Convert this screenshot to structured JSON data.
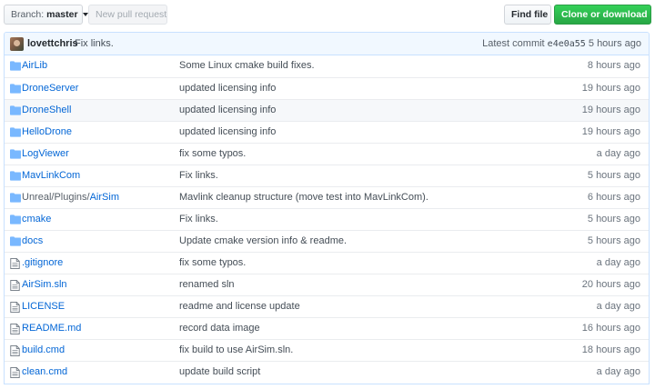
{
  "toolbar": {
    "branch_prefix": "Branch:",
    "branch_name": "master",
    "new_pr": "New pull request",
    "find_file": "Find file",
    "clone": "Clone or download"
  },
  "commit": {
    "author": "lovettchris",
    "message": "Fix links.",
    "latest_label": "Latest commit",
    "sha": "e4e0a55",
    "age": "5 hours ago"
  },
  "files": [
    {
      "type": "dir",
      "prefix": "",
      "name": "AirLib",
      "message": "Some Linux cmake build fixes.",
      "age": "8 hours ago"
    },
    {
      "type": "dir",
      "prefix": "",
      "name": "DroneServer",
      "message": "updated licensing info",
      "age": "19 hours ago"
    },
    {
      "type": "dir",
      "prefix": "",
      "name": "DroneShell",
      "message": "updated licensing info",
      "age": "19 hours ago"
    },
    {
      "type": "dir",
      "prefix": "",
      "name": "HelloDrone",
      "message": "updated licensing info",
      "age": "19 hours ago"
    },
    {
      "type": "dir",
      "prefix": "",
      "name": "LogViewer",
      "message": "fix some typos.",
      "age": "a day ago"
    },
    {
      "type": "dir",
      "prefix": "",
      "name": "MavLinkCom",
      "message": "Fix links.",
      "age": "5 hours ago"
    },
    {
      "type": "dir",
      "prefix": "Unreal/Plugins/",
      "name": "AirSim",
      "message": "Mavlink cleanup structure (move test into MavLinkCom).",
      "age": "6 hours ago"
    },
    {
      "type": "dir",
      "prefix": "",
      "name": "cmake",
      "message": "Fix links.",
      "age": "5 hours ago"
    },
    {
      "type": "dir",
      "prefix": "",
      "name": "docs",
      "message": "Update cmake version info & readme.",
      "age": "5 hours ago"
    },
    {
      "type": "file",
      "prefix": "",
      "name": ".gitignore",
      "message": "fix some typos.",
      "age": "a day ago"
    },
    {
      "type": "file",
      "prefix": "",
      "name": "AirSim.sln",
      "message": "renamed sln",
      "age": "20 hours ago"
    },
    {
      "type": "file",
      "prefix": "",
      "name": "LICENSE",
      "message": "readme and license update",
      "age": "a day ago"
    },
    {
      "type": "file",
      "prefix": "",
      "name": "README.md",
      "message": "record data image",
      "age": "16 hours ago"
    },
    {
      "type": "file",
      "prefix": "",
      "name": "build.cmd",
      "message": "fix build to use AirSim.sln.",
      "age": "18 hours ago"
    },
    {
      "type": "file",
      "prefix": "",
      "name": "clean.cmd",
      "message": "update build script",
      "age": "a day ago"
    }
  ],
  "highlighted_row": 2,
  "colors": {
    "link": "#0366d6",
    "folder_icon": "#79b8ff",
    "clone_button": "#28a745",
    "commit_bar": "#f1f8ff"
  },
  "icons": {
    "dir": "folder-icon",
    "file": "file-icon"
  }
}
